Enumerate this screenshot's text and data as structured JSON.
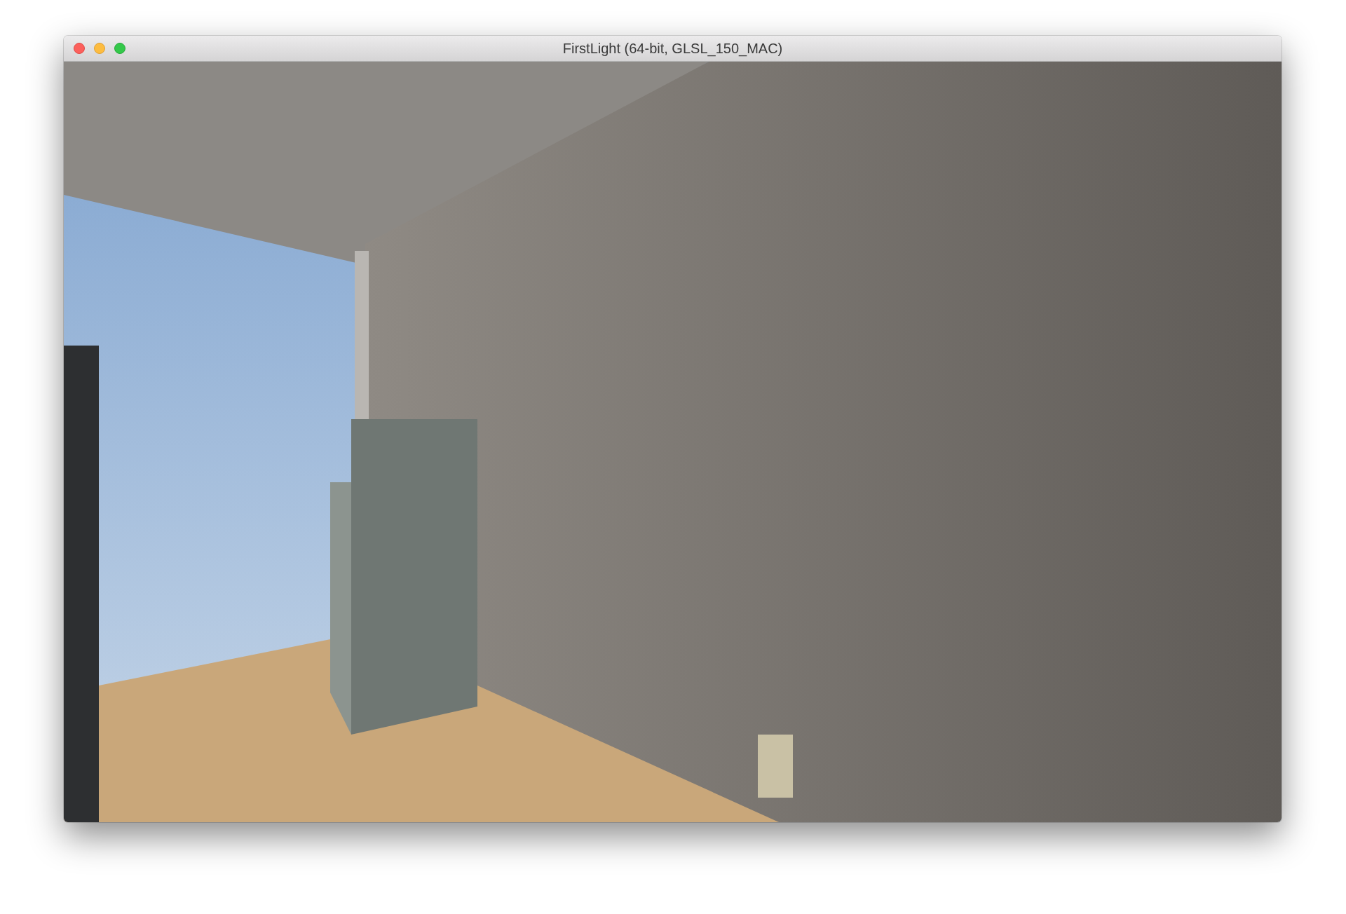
{
  "window": {
    "title": "FirstLight (64-bit, GLSL_150_MAC)"
  }
}
